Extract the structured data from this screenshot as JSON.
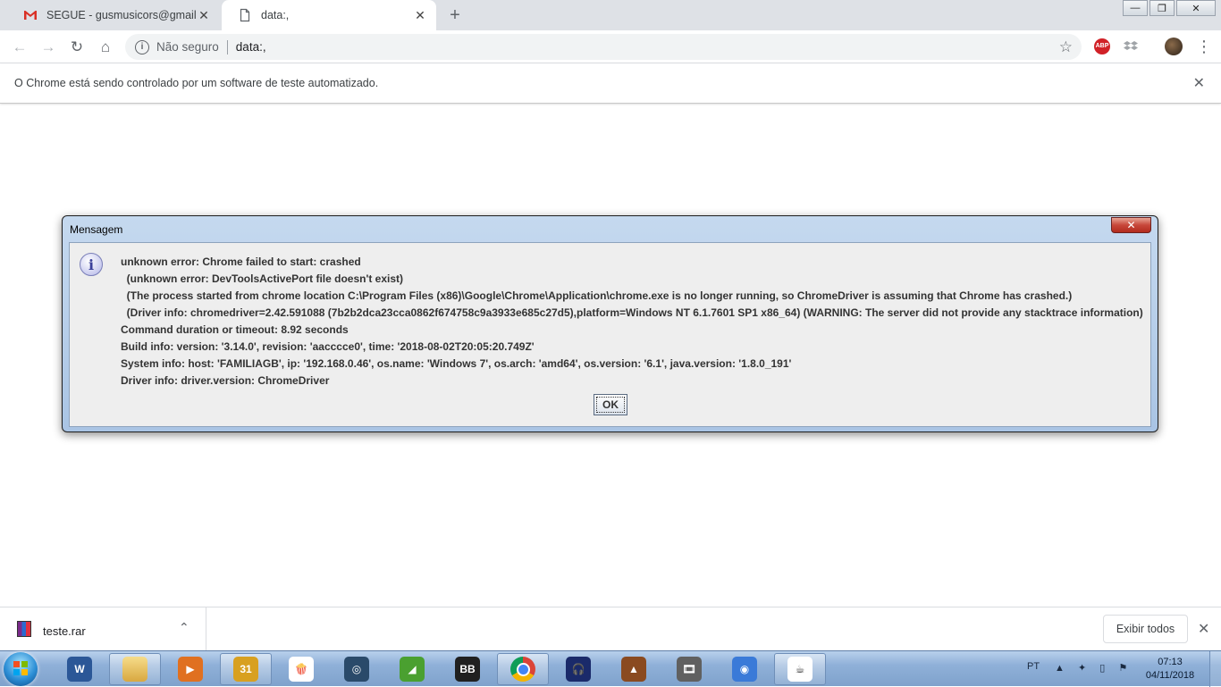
{
  "browser": {
    "tabs": [
      {
        "title": "SEGUE - gusmusicors@gmail.com",
        "close": "✕",
        "icon": "gmail-icon"
      },
      {
        "title": "data:,",
        "close": "✕",
        "icon": "page-icon"
      }
    ],
    "new_tab": "+",
    "window_controls": {
      "minimize": "—",
      "maximize": "❐",
      "close": "✕"
    },
    "toolbar": {
      "back": "←",
      "forward": "→",
      "reload": "↻",
      "home": "⌂",
      "security_text": "Não seguro",
      "url": "data:,",
      "star": "☆",
      "extension_abp": "ABP",
      "menu": "⋮"
    },
    "infobar": {
      "text": "O Chrome está sendo controlado por um software de teste automatizado.",
      "close": "✕"
    }
  },
  "dialog": {
    "title": "Mensagem",
    "close": "✕",
    "icon_glyph": "i",
    "lines": [
      "unknown error: Chrome failed to start: crashed",
      "  (unknown error: DevToolsActivePort file doesn't exist)",
      "  (The process started from chrome location C:\\Program Files (x86)\\Google\\Chrome\\Application\\chrome.exe is no longer running, so ChromeDriver is assuming that Chrome has crashed.)",
      "  (Driver info: chromedriver=2.42.591088 (7b2b2dca23cca0862f674758c9a3933e685c27d5),platform=Windows NT 6.1.7601 SP1 x86_64) (WARNING: The server did not provide any stacktrace information)",
      "Command duration or timeout: 8.92 seconds",
      "Build info: version: '3.14.0', revision: 'aacccce0', time: '2018-08-02T20:05:20.749Z'",
      "System info: host: 'FAMILIAGB', ip: '192.168.0.46', os.name: 'Windows 7', os.arch: 'amd64', os.version: '6.1', java.version: '1.8.0_191'",
      "Driver info: driver.version: ChromeDriver"
    ],
    "ok_label": "OK"
  },
  "downloads": {
    "file_name": "teste.rar",
    "chevron": "⌃",
    "show_all": "Exibir todos",
    "close": "✕"
  },
  "taskbar": {
    "apps": [
      {
        "name": "word-icon",
        "label": "W",
        "color": "#2b5797"
      },
      {
        "name": "explorer-icon",
        "label": "",
        "color": "#e8c060"
      },
      {
        "name": "media-player-icon",
        "label": "▶",
        "color": "#e07020"
      },
      {
        "name": "calendar-icon",
        "label": "31",
        "color": "#d8a020"
      },
      {
        "name": "popcorn-icon",
        "label": "🍿",
        "color": "#ffffff"
      },
      {
        "name": "sphere-app-icon",
        "label": "◎",
        "color": "#2a4a6a"
      },
      {
        "name": "green-app-icon",
        "label": "◢",
        "color": "#4aa030"
      },
      {
        "name": "game-bb-icon",
        "label": "BB",
        "color": "#202020"
      },
      {
        "name": "chrome-icon",
        "label": "",
        "color": "#ffffff"
      },
      {
        "name": "headphones-icon",
        "label": "🎧",
        "color": "#1a2a6a"
      },
      {
        "name": "metronome-icon",
        "label": "▲",
        "color": "#8a4a20"
      },
      {
        "name": "film-reel-icon",
        "label": "🎞",
        "color": "#606060"
      },
      {
        "name": "chromium-icon",
        "label": "◉",
        "color": "#3a7ad8"
      },
      {
        "name": "java-icon",
        "label": "☕",
        "color": "#ffffff"
      }
    ],
    "tray_lang": "PT",
    "tray_icons": "▲ ✦ ▯ ⚑",
    "clock_time": "07:13",
    "clock_date": "04/11/2018"
  }
}
